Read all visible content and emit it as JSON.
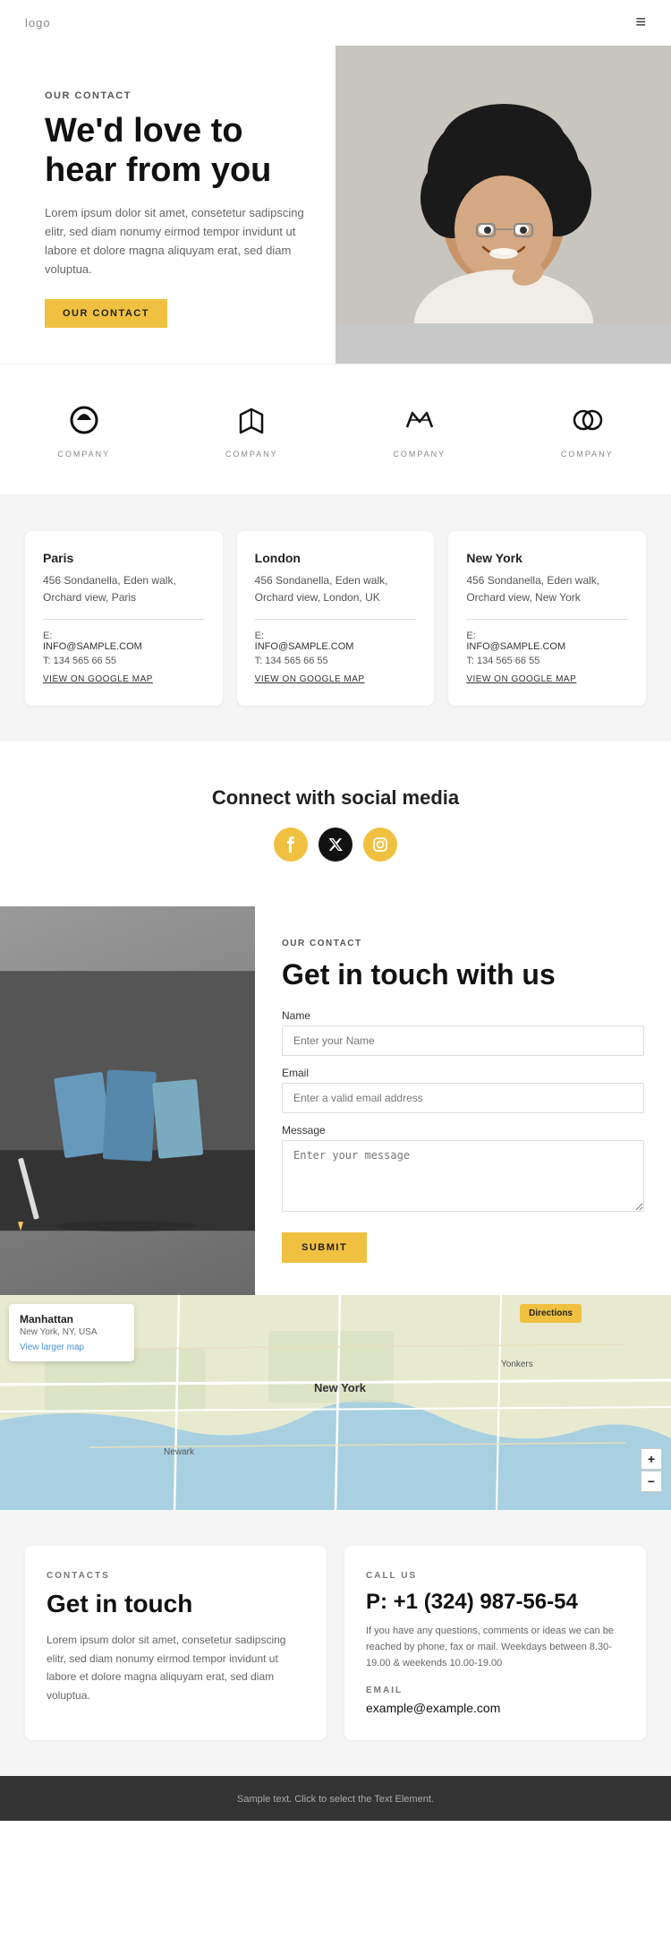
{
  "header": {
    "logo": "logo",
    "menu_icon": "≡"
  },
  "hero": {
    "eyebrow": "OUR CONTACT",
    "title": "We'd love to hear from you",
    "description": "Lorem ipsum dolor sit amet, consetetur sadipscing elitr, sed diam nonumy eirmod tempor invidunt ut labore et dolore magna aliquyam erat, sed diam voluptua.",
    "cta_label": "OUR CONTACT"
  },
  "logos": [
    {
      "name": "COMPANY"
    },
    {
      "name": "COMPANY"
    },
    {
      "name": "COMPANY"
    },
    {
      "name": "COMPANY"
    }
  ],
  "offices": [
    {
      "city": "Paris",
      "address": "456 Sondanella, Eden walk, Orchard view, Paris",
      "email_label": "E:",
      "email": "INFO@SAMPLE.COM",
      "phone_label": "T:",
      "phone": "134 565 66 55",
      "map_link": "VIEW ON GOOGLE MAP"
    },
    {
      "city": "London",
      "address": "456 Sondanella, Eden walk, Orchard view, London, UK",
      "email_label": "E:",
      "email": "INFO@SAMPLE.COM",
      "phone_label": "T:",
      "phone": "134 565 66 55",
      "map_link": "VIEW ON GOOGLE MAP"
    },
    {
      "city": "New York",
      "address": "456 Sondanella, Eden walk, Orchard view, New York",
      "email_label": "E:",
      "email": "INFO@SAMPLE.COM",
      "phone_label": "T:",
      "phone": "134 565 66 55",
      "map_link": "VIEW ON GOOGLE MAP"
    }
  ],
  "social": {
    "title": "Connect with social media",
    "icons": [
      "f",
      "𝕏",
      "◎"
    ]
  },
  "contact_form": {
    "eyebrow": "OUR CONTACT",
    "title": "Get in touch with us",
    "name_label": "Name",
    "name_placeholder": "Enter your Name",
    "email_label": "Email",
    "email_placeholder": "Enter a valid email address",
    "message_label": "Message",
    "message_placeholder": "Enter your message",
    "submit_label": "SUBMIT"
  },
  "map": {
    "city": "Manhattan",
    "address": "New York, NY, USA",
    "view_link": "View larger map",
    "directions_label": "Directions",
    "zoom_in": "+",
    "zoom_out": "−"
  },
  "bottom_contact": {
    "left": {
      "eyebrow": "CONTACTS",
      "title": "Get in touch",
      "description": "Lorem ipsum dolor sit amet, consetetur sadipscing elitr, sed diam nonumy eirmod tempor invidunt ut labore et dolore magna aliquyam erat, sed diam voluptua."
    },
    "right": {
      "eyebrow": "CALL US",
      "phone": "P: +1 (324) 987-56-54",
      "call_desc": "If you have any questions, comments or ideas we can be reached by phone, fax or mail. Weekdays between 8.30-19.00 & weekends 10.00-19.00",
      "email_label": "EMAIL",
      "email": "example@example.com"
    }
  },
  "footer": {
    "text": "Sample text. Click to select the Text Element."
  }
}
